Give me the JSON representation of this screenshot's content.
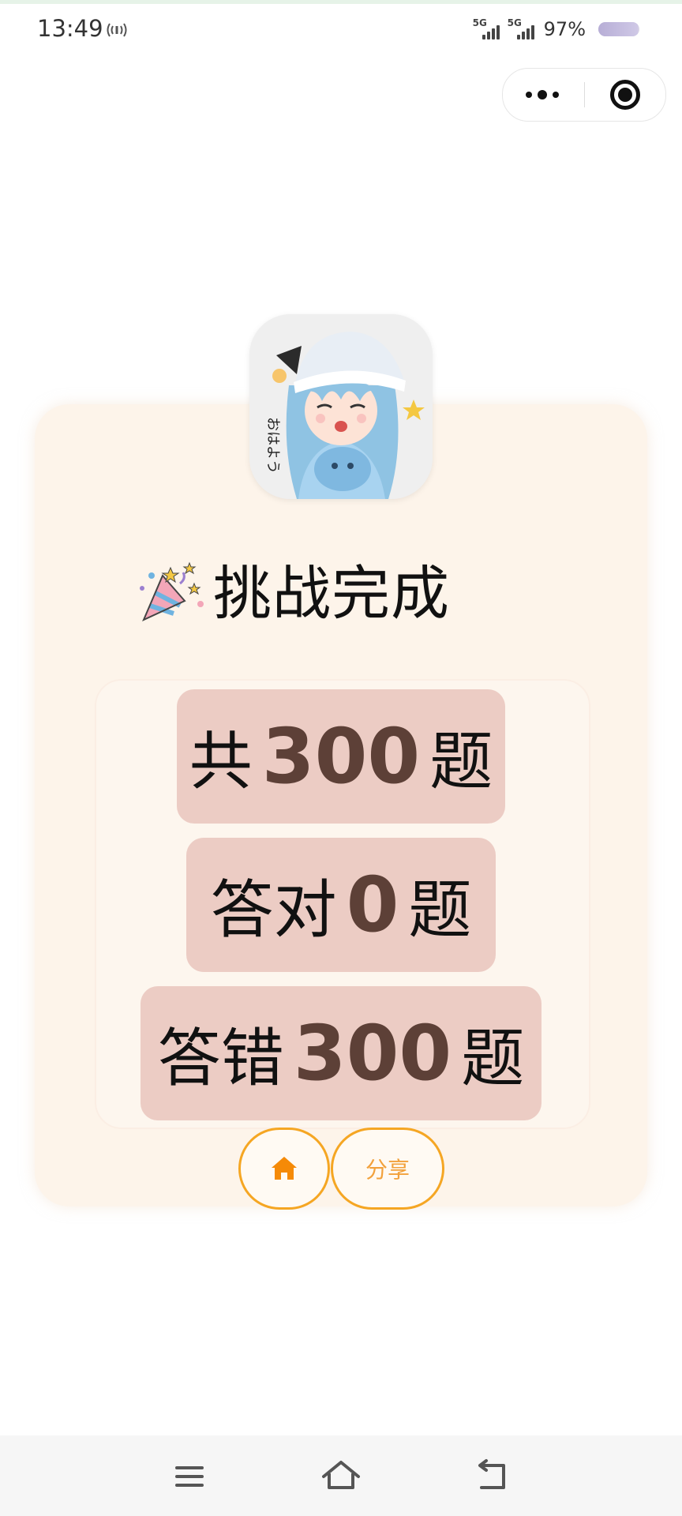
{
  "status_bar": {
    "time": "13:49",
    "signal_label": "5G",
    "battery_percent_text": "97%",
    "battery_level": 0.97,
    "icons": [
      "hotspot-icon",
      "signal-5g-icon",
      "signal-5g-icon",
      "battery-icon"
    ]
  },
  "capsule": {
    "icons": [
      "more-dots-icon",
      "close-target-icon"
    ]
  },
  "result": {
    "avatar": "anime-girl-sticker",
    "title_icon": "party-popper-icon",
    "title": "挑战完成",
    "total": {
      "prefix": "共",
      "value": "300",
      "suffix": "题"
    },
    "correct": {
      "prefix": "答对",
      "value": "0",
      "suffix": "题"
    },
    "wrong": {
      "prefix": "答错",
      "value": "300",
      "suffix": "题"
    },
    "home_icon": "home-icon",
    "share_label": "分享"
  },
  "colors": {
    "card_bg": "#fdf4ea",
    "stat_bg": "#ecccc4",
    "stat_number": "#5d4037",
    "accent": "#f5a623"
  },
  "nav_bar": {
    "icons": [
      "menu-icon",
      "home-outline-icon",
      "back-icon"
    ]
  }
}
